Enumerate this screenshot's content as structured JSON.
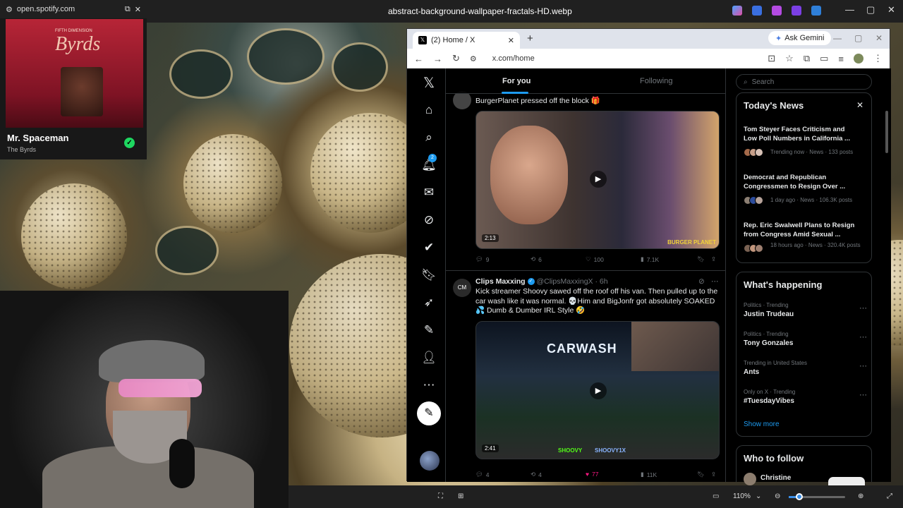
{
  "viewer": {
    "title": "abstract-background-wallpaper-fractals-HD.webp",
    "zoom": "110%"
  },
  "spotify": {
    "url": "open.spotify.com",
    "album_small": "FIFTH DIMENSION",
    "album_band": "Byrds",
    "song": "Mr. Spaceman",
    "artist": "The Byrds"
  },
  "browser": {
    "tab_title": "(2) Home / X",
    "url": "x.com/home",
    "gemini": "Ask Gemini"
  },
  "x": {
    "notif_count": "2",
    "tabs": {
      "for_you": "For you",
      "following": "Following"
    },
    "posts": [
      {
        "text": "BurgerPlanet pressed off the block 🎁",
        "duration": "2:13",
        "replies": "9",
        "reposts": "6",
        "likes": "100",
        "views": "7.1K",
        "caption": "BURGER PLANET"
      },
      {
        "avatar": "CM",
        "name": "Clips Maxxing",
        "handle": "@ClipsMaxxingX · 6h",
        "text": "Kick streamer Shoovy sawed off the roof off his van. Then pulled up to the car wash like it was normal. 💀Him and BigJonfr got absolutely SOAKED 💦 Dumb & Dumber IRL Style 🤣",
        "sign": "CARWASH",
        "duration": "2:41",
        "tag1": "SHOOVY",
        "tag2": "SHOOVY1X",
        "replies": "4",
        "reposts": "4",
        "likes": "77",
        "views": "11K"
      }
    ],
    "search_placeholder": "Search",
    "news": {
      "title": "Today's News",
      "items": [
        {
          "title": "Tom Steyer Faces Criticism and Low Poll Numbers in California ...",
          "meta": "Trending now · News · 133 posts"
        },
        {
          "title": "Democrat and Republican Congressmen to Resign Over ...",
          "meta": "1 day ago · News · 106.3K posts"
        },
        {
          "title": "Rep. Eric Swalwell Plans to Resign from Congress Amid Sexual ...",
          "meta": "18 hours ago · News · 320.4K posts"
        }
      ]
    },
    "happening": {
      "title": "What's happening",
      "items": [
        {
          "cat": "Politics · Trending",
          "name": "Justin Trudeau"
        },
        {
          "cat": "Politics · Trending",
          "name": "Tony Gonzales"
        },
        {
          "cat": "Trending in United States",
          "name": "Ants"
        },
        {
          "cat": "Only on X · Trending",
          "name": "#TuesdayVibes"
        }
      ],
      "show_more": "Show more"
    },
    "follow": {
      "title": "Who to follow",
      "first": "Christine"
    }
  }
}
